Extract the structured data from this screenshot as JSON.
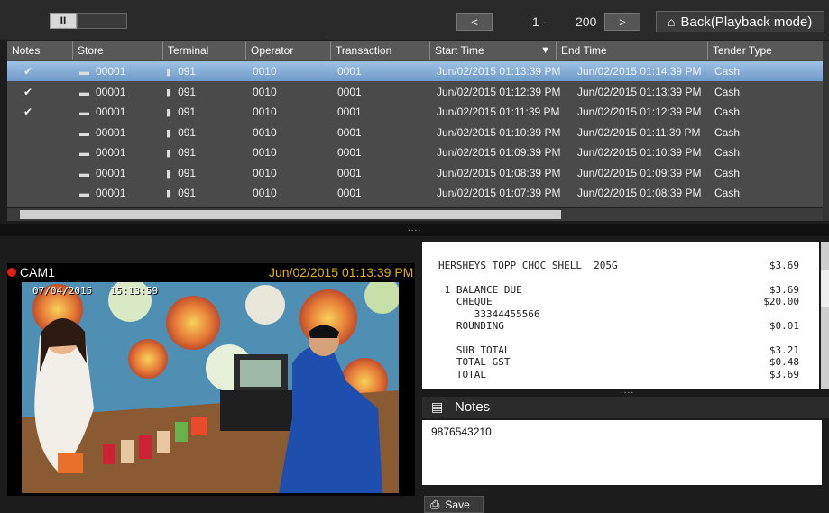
{
  "toolbar": {
    "pause_icon": "II",
    "prev_icon": "<",
    "page_start": "1 -",
    "page_end": "200",
    "next_icon": ">",
    "back_label": "Back(Playback mode)",
    "back_icon": "home-icon"
  },
  "table": {
    "columns": [
      "Notes",
      "Store",
      "Terminal",
      "Operator",
      "Transaction",
      "Start Time",
      "End Time",
      "Tender Type"
    ],
    "sort_indicator": "▼",
    "rows": [
      {
        "note": "✔",
        "store": "00001",
        "terminal": "091",
        "operator": "0010",
        "transaction": "0001",
        "start": "Jun/02/2015 01:13:39 PM",
        "end": "Jun/02/2015 01:14:39 PM",
        "tender": "Cash"
      },
      {
        "note": "✔",
        "store": "00001",
        "terminal": "091",
        "operator": "0010",
        "transaction": "0001",
        "start": "Jun/02/2015 01:12:39 PM",
        "end": "Jun/02/2015 01:13:39 PM",
        "tender": "Cash"
      },
      {
        "note": "✔",
        "store": "00001",
        "terminal": "091",
        "operator": "0010",
        "transaction": "0001",
        "start": "Jun/02/2015 01:11:39 PM",
        "end": "Jun/02/2015 01:12:39 PM",
        "tender": "Cash"
      },
      {
        "note": "",
        "store": "00001",
        "terminal": "091",
        "operator": "0010",
        "transaction": "0001",
        "start": "Jun/02/2015 01:10:39 PM",
        "end": "Jun/02/2015 01:11:39 PM",
        "tender": "Cash"
      },
      {
        "note": "",
        "store": "00001",
        "terminal": "091",
        "operator": "0010",
        "transaction": "0001",
        "start": "Jun/02/2015 01:09:39 PM",
        "end": "Jun/02/2015 01:10:39 PM",
        "tender": "Cash"
      },
      {
        "note": "",
        "store": "00001",
        "terminal": "091",
        "operator": "0010",
        "transaction": "0001",
        "start": "Jun/02/2015 01:08:39 PM",
        "end": "Jun/02/2015 01:09:39 PM",
        "tender": "Cash"
      },
      {
        "note": "",
        "store": "00001",
        "terminal": "091",
        "operator": "0010",
        "transaction": "0001",
        "start": "Jun/02/2015 01:07:39 PM",
        "end": "Jun/02/2015 01:08:39 PM",
        "tender": "Cash"
      }
    ]
  },
  "splitter": {
    "dots": "...."
  },
  "video": {
    "camera": "CAM1",
    "timestamp": "Jun/02/2015 01:13:39 PM",
    "osd_date": "07/04/2015",
    "osd_time": "15:13:59"
  },
  "receipt": {
    "lines": [
      {
        "left": "HERSHEYS TOPP CHOC SHELL  205G",
        "right": "$3.69"
      },
      {
        "left": "",
        "right": ""
      },
      {
        "left": " 1 BALANCE DUE",
        "right": "$3.69"
      },
      {
        "left": "   CHEQUE",
        "right": "$20.00"
      },
      {
        "left": "      33344455566",
        "right": ""
      },
      {
        "left": "   ROUNDING",
        "right": "$0.01"
      },
      {
        "left": "",
        "right": ""
      },
      {
        "left": "   SUB TOTAL",
        "right": "$3.21"
      },
      {
        "left": "   TOTAL GST",
        "right": "$0.48"
      },
      {
        "left": "   TOTAL",
        "right": "$3.69"
      }
    ]
  },
  "notes": {
    "title": "Notes",
    "text": "9876543210",
    "save_label": "Save"
  },
  "colors": {
    "selected_row": "#7fa8d4",
    "timestamp": "#e0b400",
    "record": "#dd2211"
  }
}
